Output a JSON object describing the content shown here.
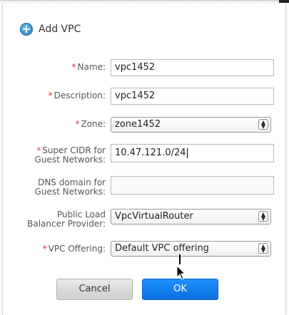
{
  "dialog": {
    "title": "Add VPC",
    "icon": "add-circle-icon",
    "accent_color": "#1f7cc4"
  },
  "form": {
    "name": {
      "label": "Name:",
      "required": true,
      "value": "vpc1452"
    },
    "description": {
      "label": "Description:",
      "required": true,
      "value": "vpc1452"
    },
    "zone": {
      "label": "Zone:",
      "required": true,
      "value": "zone1452"
    },
    "super_cidr": {
      "label_line1": "Super CIDR for",
      "label_line2": "Guest Networks:",
      "required": true,
      "value": "10.47.121.0/24"
    },
    "dns_domain": {
      "label_line1": "DNS domain for",
      "label_line2": "Guest Networks:",
      "required": false,
      "value": ""
    },
    "lb_provider": {
      "label_line1": "Public Load",
      "label_line2": "Balancer Provider:",
      "required": false,
      "value": "VpcVirtualRouter"
    },
    "vpc_offering": {
      "label": "VPC Offering:",
      "required": true,
      "value": "Default VPC offering"
    }
  },
  "required_marker": "*",
  "buttons": {
    "cancel_label": "Cancel",
    "ok_label": "OK",
    "ok_color": "#0a6fe0"
  }
}
